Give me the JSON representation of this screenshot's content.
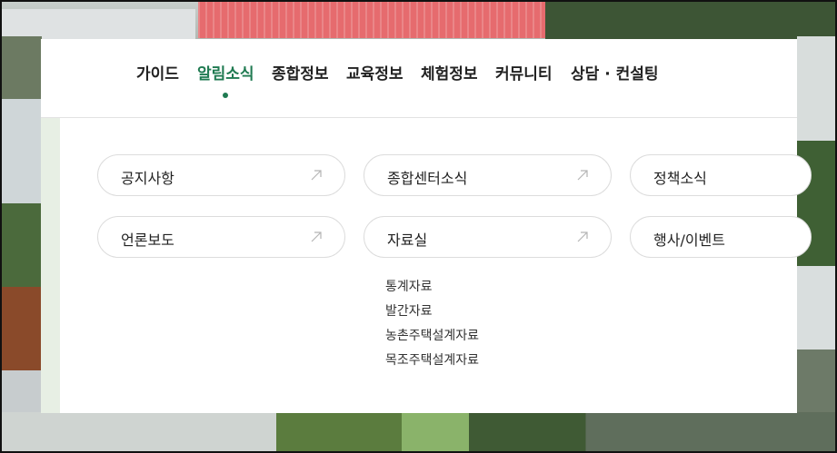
{
  "nav": {
    "items": [
      "가이드",
      "알림소식",
      "종합정보",
      "교육정보",
      "체험정보",
      "커뮤니티",
      "상담 · 컨설팅"
    ],
    "active_index": 1,
    "accent_color": "#1f7a51"
  },
  "menu": {
    "row1": [
      "공지사항",
      "종합센터소식",
      "정책소식"
    ],
    "row2": [
      "언론보도",
      "자료실",
      "행사/이벤트"
    ],
    "arrow_icon": "arrow-up-right-icon"
  },
  "submenu": {
    "items": [
      "통계자료",
      "발간자료",
      "농촌주택설계자료",
      "목조주택설계자료"
    ]
  }
}
